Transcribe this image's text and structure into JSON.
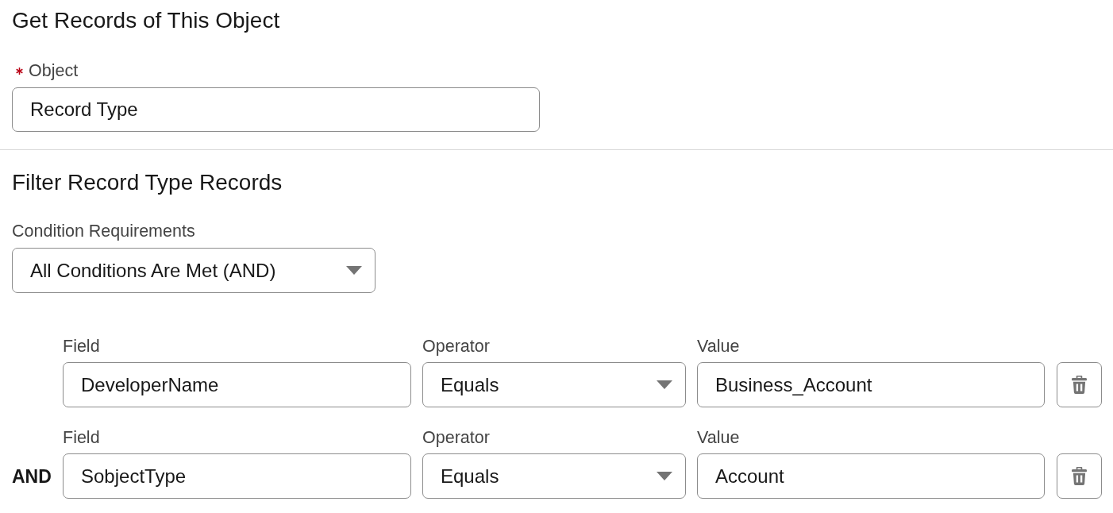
{
  "object_section": {
    "title": "Get Records of This Object",
    "object_field": {
      "label": "Object",
      "required": true,
      "value": "Record Type"
    }
  },
  "filter_section": {
    "title": "Filter Record Type Records",
    "condition_requirements": {
      "label": "Condition Requirements",
      "value": "All Conditions Are Met (AND)"
    },
    "conditions": [
      {
        "field": {
          "label": "Field",
          "value": "DeveloperName"
        },
        "operator": {
          "label": "Operator",
          "value": "Equals"
        },
        "value": {
          "label": "Value",
          "value": "Business_Account"
        }
      },
      {
        "connector": "AND",
        "field": {
          "label": "Field",
          "value": "SobjectType"
        },
        "operator": {
          "label": "Operator",
          "value": "Equals"
        },
        "value": {
          "label": "Value",
          "value": "Account"
        }
      }
    ]
  }
}
